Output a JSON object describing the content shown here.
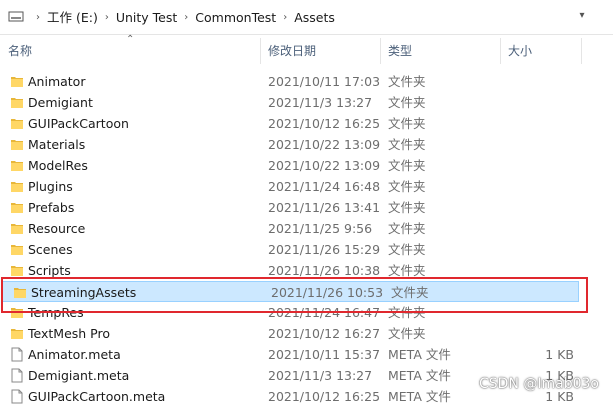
{
  "address": {
    "crumbs": [
      "工作 (E:)",
      "Unity Test",
      "CommonTest",
      "Assets"
    ],
    "separator": "›"
  },
  "columns": {
    "name": "名称",
    "date": "修改日期",
    "type": "类型",
    "size": "大小"
  },
  "files": [
    {
      "name": "Animator",
      "date": "2021/10/11 17:03",
      "type": "文件夹",
      "size": "",
      "kind": "folder"
    },
    {
      "name": "Demigiant",
      "date": "2021/11/3 13:27",
      "type": "文件夹",
      "size": "",
      "kind": "folder"
    },
    {
      "name": "GUIPackCartoon",
      "date": "2021/10/12 16:25",
      "type": "文件夹",
      "size": "",
      "kind": "folder"
    },
    {
      "name": "Materials",
      "date": "2021/10/22 13:09",
      "type": "文件夹",
      "size": "",
      "kind": "folder"
    },
    {
      "name": "ModelRes",
      "date": "2021/10/22 13:09",
      "type": "文件夹",
      "size": "",
      "kind": "folder"
    },
    {
      "name": "Plugins",
      "date": "2021/11/24 16:48",
      "type": "文件夹",
      "size": "",
      "kind": "folder"
    },
    {
      "name": "Prefabs",
      "date": "2021/11/26 13:41",
      "type": "文件夹",
      "size": "",
      "kind": "folder"
    },
    {
      "name": "Resource",
      "date": "2021/11/25 9:56",
      "type": "文件夹",
      "size": "",
      "kind": "folder"
    },
    {
      "name": "Scenes",
      "date": "2021/11/26 15:29",
      "type": "文件夹",
      "size": "",
      "kind": "folder"
    },
    {
      "name": "Scripts",
      "date": "2021/11/26 10:38",
      "type": "文件夹",
      "size": "",
      "kind": "folder"
    },
    {
      "name": "StreamingAssets",
      "date": "2021/11/26 10:53",
      "type": "文件夹",
      "size": "",
      "kind": "folder",
      "selected": true
    },
    {
      "name": "TempRes",
      "date": "2021/11/24 16:47",
      "type": "文件夹",
      "size": "",
      "kind": "folder"
    },
    {
      "name": "TextMesh Pro",
      "date": "2021/10/12 16:27",
      "type": "文件夹",
      "size": "",
      "kind": "folder"
    },
    {
      "name": "Animator.meta",
      "date": "2021/10/11 15:37",
      "type": "META 文件",
      "size": "1 KB",
      "kind": "file"
    },
    {
      "name": "Demigiant.meta",
      "date": "2021/11/3 13:27",
      "type": "META 文件",
      "size": "1 KB",
      "kind": "file"
    },
    {
      "name": "GUIPackCartoon.meta",
      "date": "2021/10/12 16:25",
      "type": "META 文件",
      "size": "1 KB",
      "kind": "file"
    }
  ],
  "watermark": "CSDN @Imab03o",
  "colors": {
    "selection": "#cce8ff",
    "highlight": "#e0282e",
    "folder": "#ffd766"
  }
}
